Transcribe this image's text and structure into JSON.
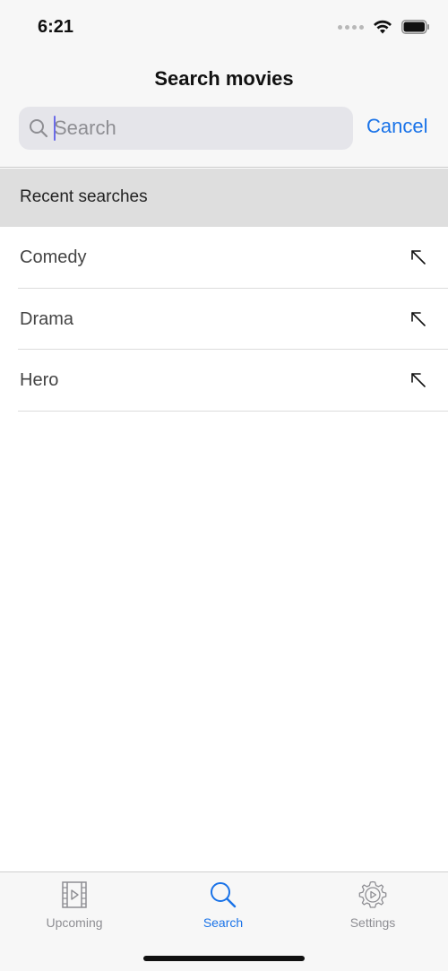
{
  "status_bar": {
    "time": "6:21",
    "icons": [
      "signal-dots-icon",
      "wifi-icon",
      "battery-icon"
    ]
  },
  "header": {
    "title": "Search movies",
    "search": {
      "placeholder": "Search",
      "value": ""
    },
    "cancel_label": "Cancel"
  },
  "recent": {
    "title": "Recent searches",
    "items": [
      {
        "label": "Comedy",
        "icon": "arrow-up-left-icon"
      },
      {
        "label": "Drama",
        "icon": "arrow-up-left-icon"
      },
      {
        "label": "Hero",
        "icon": "arrow-up-left-icon"
      }
    ]
  },
  "tab_bar": {
    "tabs": [
      {
        "label": "Upcoming",
        "icon": "film-play-icon",
        "active": false
      },
      {
        "label": "Search",
        "icon": "search-icon",
        "active": true
      },
      {
        "label": "Settings",
        "icon": "gear-play-icon",
        "active": false
      }
    ]
  },
  "colors": {
    "accent": "#1a73e8",
    "inactive": "#8e8e93",
    "header_bg": "#f7f7f7",
    "section_bg": "#dedede",
    "search_bg": "#e5e5ea"
  }
}
